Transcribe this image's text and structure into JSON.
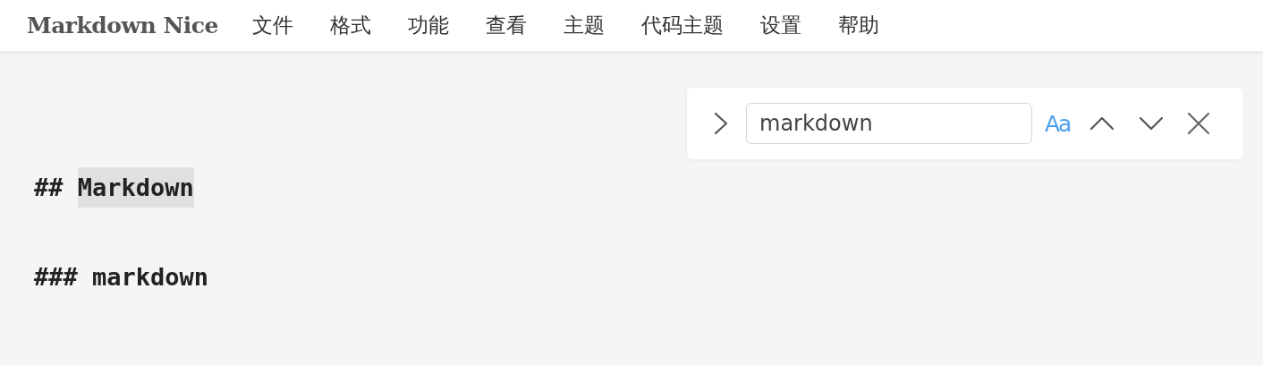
{
  "app_title": "Markdown Nice",
  "menu": [
    "文件",
    "格式",
    "功能",
    "查看",
    "主题",
    "代码主题",
    "设置",
    "帮助"
  ],
  "find_widget": {
    "expanded": false,
    "search": {
      "value": "markdown"
    },
    "case_toggle": {
      "label": "Aa",
      "on": true
    }
  },
  "editor": {
    "lines": [
      {
        "segments": [
          {
            "text": "## ",
            "highlighted": false
          },
          {
            "text": "Markdown",
            "highlighted": true
          }
        ]
      },
      {
        "segments": [
          {
            "text": "### markdown",
            "highlighted": false
          }
        ]
      }
    ]
  }
}
